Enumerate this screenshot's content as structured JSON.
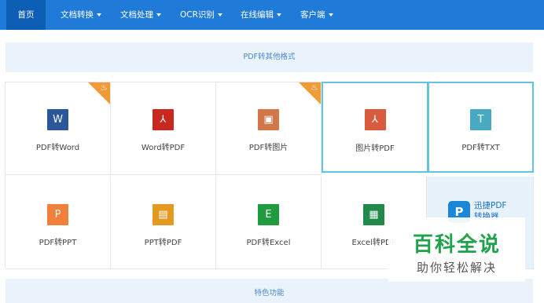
{
  "nav": {
    "home": "首页",
    "items": [
      {
        "label": "文档转换"
      },
      {
        "label": "文档处理"
      },
      {
        "label": "OCR识别"
      },
      {
        "label": "在线编辑"
      },
      {
        "label": "客户端"
      }
    ]
  },
  "sections": {
    "formats_title": "PDF转其他格式",
    "features_title": "特色功能"
  },
  "tools": {
    "pdf_to_word": {
      "label": "PDF转Word",
      "icon": "word-icon",
      "glyph": "W",
      "color": "#2b579a",
      "hot": true
    },
    "word_to_pdf": {
      "label": "Word转PDF",
      "icon": "pdf-icon",
      "glyph": "⅄",
      "color": "#c8281e",
      "hot": false
    },
    "pdf_to_image": {
      "label": "PDF转图片",
      "icon": "image-icon",
      "glyph": "▣",
      "color": "#d2774a",
      "hot": true
    },
    "image_to_pdf": {
      "label": "图片转PDF",
      "icon": "pdf-icon",
      "glyph": "⅄",
      "color": "#d85b3d",
      "hot": false
    },
    "pdf_to_txt": {
      "label": "PDF转TXT",
      "icon": "text-icon",
      "glyph": "T",
      "color": "#4aa9c2",
      "hot": false
    },
    "pdf_to_ppt": {
      "label": "PDF转PPT",
      "icon": "powerpoint-icon",
      "glyph": "P",
      "color": "#f0803a",
      "hot": false
    },
    "ppt_to_pdf": {
      "label": "PPT转PDF",
      "icon": "slides-icon",
      "glyph": "▤",
      "color": "#e39a1f",
      "hot": false
    },
    "pdf_to_excel": {
      "label": "PDF转Excel",
      "icon": "excel-icon",
      "glyph": "E",
      "color": "#1e9c3f",
      "hot": false
    },
    "excel_to_pdf": {
      "label": "Excel转PDF",
      "icon": "spreadsheet-icon",
      "glyph": "▦",
      "color": "#218a4a",
      "hot": false
    }
  },
  "promo": {
    "line1": "迅捷PDF",
    "line2": "转换器",
    "logo_glyph": "P",
    "brand_color": "#1a86d9"
  },
  "watermark": {
    "title": "百科全说",
    "subtitle": "助你轻松解决"
  },
  "colors": {
    "nav_bg": "#1f7ad8",
    "nav_active": "#0d5fb6",
    "section_bg": "#eaf3fc",
    "highlight_border": "#5ec6e0",
    "hot_badge": "#f29b36",
    "watermark_green": "#1ea24a"
  }
}
